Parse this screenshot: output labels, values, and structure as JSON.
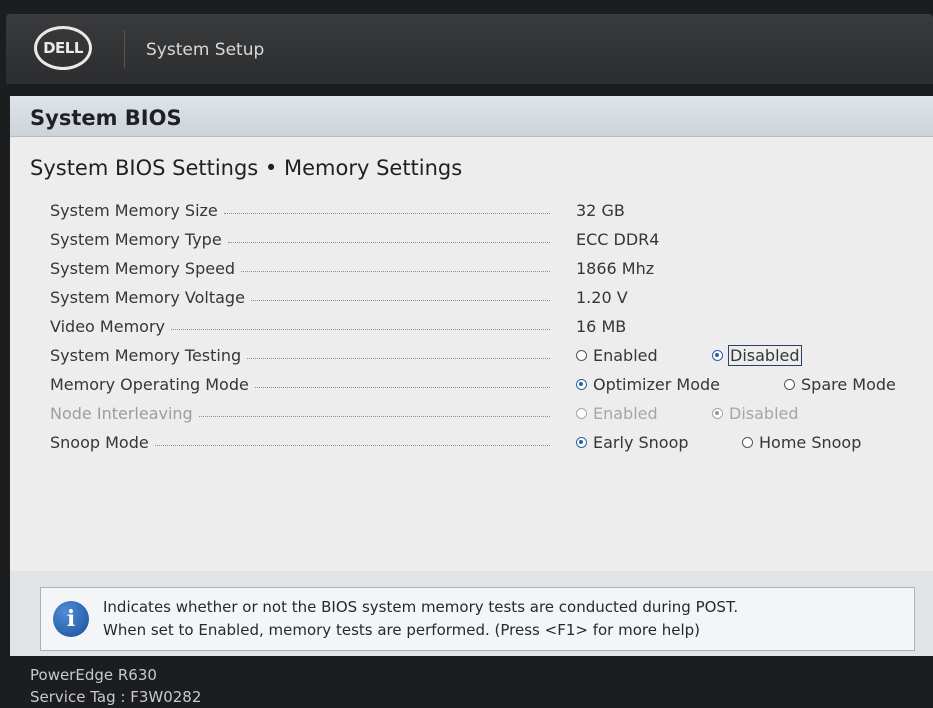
{
  "header": {
    "logo_text": "DELL",
    "title": "System Setup"
  },
  "section": {
    "title": "System BIOS",
    "subtitle": "System BIOS Settings • Memory Settings"
  },
  "settings": [
    {
      "label": "System Memory Size",
      "value": "32 GB"
    },
    {
      "label": "System Memory Type",
      "value": "ECC DDR4"
    },
    {
      "label": "System Memory Speed",
      "value": "1866 Mhz"
    },
    {
      "label": "System Memory Voltage",
      "value": "1.20 V"
    },
    {
      "label": "Video Memory",
      "value": "16 MB"
    },
    {
      "label": "System Memory Testing",
      "options": [
        "Enabled",
        "Disabled"
      ],
      "selected": "Disabled"
    },
    {
      "label": "Memory Operating Mode",
      "options": [
        "Optimizer Mode",
        "Spare Mode"
      ],
      "selected": "Optimizer Mode"
    },
    {
      "label": "Node Interleaving",
      "options": [
        "Enabled",
        "Disabled"
      ],
      "selected": "Disabled"
    },
    {
      "label": "Snoop Mode",
      "options": [
        "Early Snoop",
        "Home Snoop"
      ],
      "selected": "Early Snoop"
    }
  ],
  "help": {
    "line1": "Indicates whether or not the BIOS system memory tests are conducted during POST.",
    "line2": "When set to Enabled, memory tests are performed. (Press <F1> for more help)"
  },
  "footer": {
    "model": "PowerEdge R630",
    "service_tag": "Service Tag : F3W0282"
  },
  "colors": {
    "accent": "#2a5fa8",
    "header_bg": "#2c2d2f",
    "panel_bg": "#ededee"
  }
}
